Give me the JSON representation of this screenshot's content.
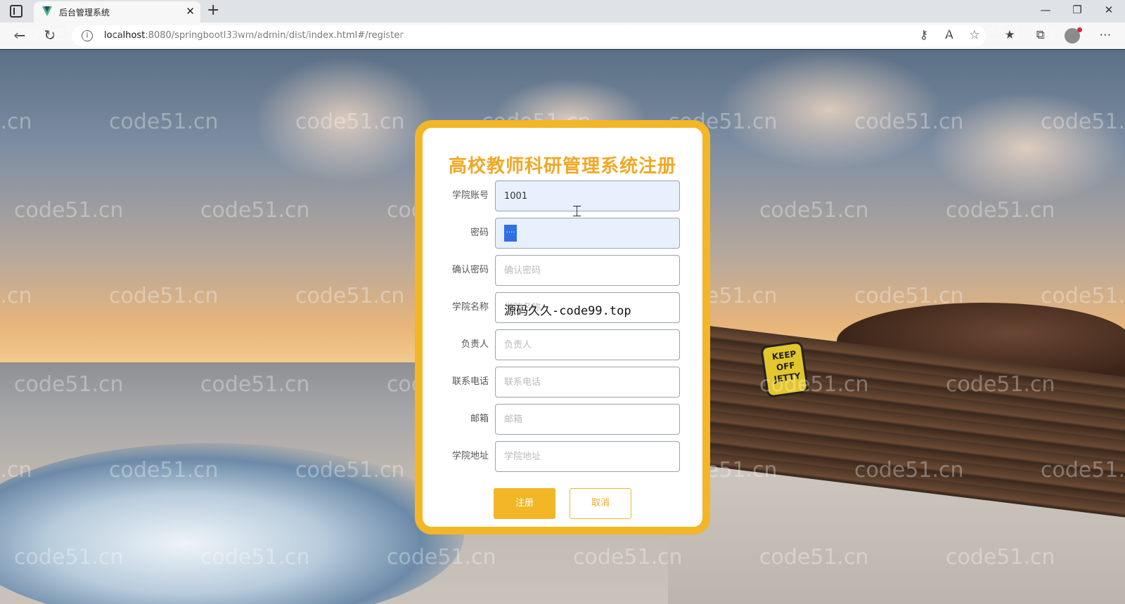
{
  "browser": {
    "tab_title": "后台管理系统",
    "new_tab": "+",
    "url_host": "localhost",
    "url_rest": ":8080/springbootl33wm/admin/dist/index.html#/register"
  },
  "watermark": "code51.cn",
  "page": {
    "title": "高校教师科研管理系统注册",
    "sign_text": "KEEP OFF JETTY",
    "fields": [
      {
        "label": "学院账号",
        "value": "1001",
        "placeholder": ""
      },
      {
        "label": "密码",
        "value": "····",
        "placeholder": ""
      },
      {
        "label": "确认密码",
        "value": "",
        "placeholder": "确认密码"
      },
      {
        "label": "学院名称",
        "value": "",
        "placeholder": "学院名称"
      },
      {
        "label": "负责人",
        "value": "",
        "placeholder": "负责人"
      },
      {
        "label": "联系电话",
        "value": "",
        "placeholder": "联系电话"
      },
      {
        "label": "邮箱",
        "value": "",
        "placeholder": "邮箱"
      },
      {
        "label": "学院地址",
        "value": "",
        "placeholder": "学院地址"
      }
    ],
    "overlay_text": "源码久久-code99.top",
    "buttons": {
      "register": "注册",
      "cancel": "取消"
    }
  },
  "colors": {
    "accent": "#f2b627",
    "title": "#f0a824",
    "input_filled": "#e8f0fe"
  }
}
